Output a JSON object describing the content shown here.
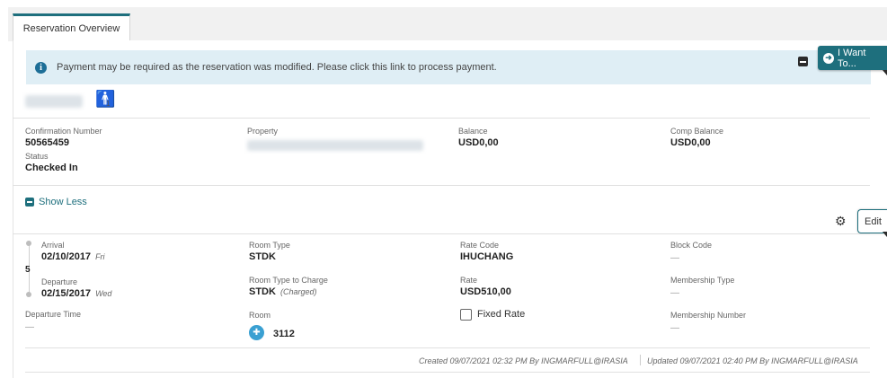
{
  "tabs": [
    {
      "label": "Reservation Overview",
      "active": true
    }
  ],
  "banner": {
    "message": "Payment may be required as the reservation was modified. Please click this link to process payment.",
    "info_glyph": "i"
  },
  "i_want_to": {
    "label": "I Want To..."
  },
  "guest": {
    "count": "1"
  },
  "summary": {
    "confirmation_label": "Confirmation Number",
    "confirmation_value": "50565459",
    "status_label": "Status",
    "status_value": "Checked In",
    "property_label": "Property",
    "balance_label": "Balance",
    "balance_value": "USD0,00",
    "comp_balance_label": "Comp Balance",
    "comp_balance_value": "USD0,00"
  },
  "toggle": {
    "label": "Show Less"
  },
  "edit": {
    "label": "Edit"
  },
  "stay": {
    "arrival_label": "Arrival",
    "arrival_date": "02/10/2017",
    "arrival_day": "Fri",
    "nights": "5",
    "departure_label": "Departure",
    "departure_date": "02/15/2017",
    "departure_day": "Wed",
    "departure_time_label": "Departure Time",
    "departure_time_value": "—"
  },
  "room": {
    "room_type_label": "Room Type",
    "room_type_value": "STDK",
    "room_type_charge_label": "Room Type to Charge",
    "room_type_charge_value": "STDK",
    "room_type_charge_note": "(Charged)",
    "room_label": "Room",
    "room_value": "3112"
  },
  "rate": {
    "rate_code_label": "Rate Code",
    "rate_code_value": "IHUCHANG",
    "rate_label": "Rate",
    "rate_value": "USD510,00",
    "fixed_rate_label": "Fixed Rate",
    "fixed_rate_checked": false
  },
  "block": {
    "block_code_label": "Block Code",
    "block_code_value": "—",
    "membership_type_label": "Membership Type",
    "membership_type_value": "—",
    "membership_number_label": "Membership Number",
    "membership_number_value": "—"
  },
  "footer": {
    "created": "Created 09/07/2021 02:32 PM By INGMARFULL@IRASIA",
    "updated": "Updated 09/07/2021 02:40 PM By INGMARFULL@IRASIA"
  },
  "colors": {
    "accent": "#1e6f7d",
    "banner_bg": "#dfeef5",
    "info_icon": "#1d6e97",
    "room_icon": "#3aa0d2"
  }
}
